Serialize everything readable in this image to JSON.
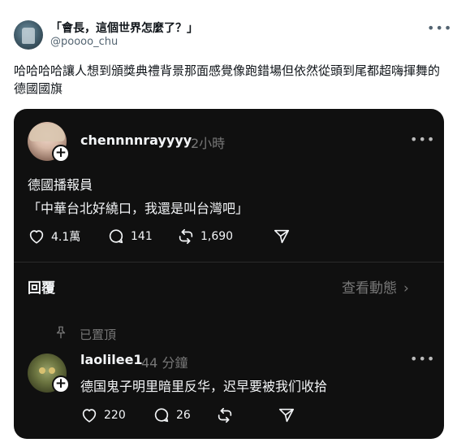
{
  "tweet": {
    "display_name": "「會長，這個世界怎麼了？」",
    "handle": "@poooo_chu",
    "more_icon": "more-horizontal-icon",
    "text": "哈哈哈哈讓人想到頒獎典禮背景那面感覺像跑錯場但依然從頭到尾都超嗨揮舞的德國國旗"
  },
  "card": {
    "post": {
      "username": "chennnnrayyyy",
      "time": "2小時",
      "line1": "德國播報員",
      "line2": "「中華台北好繞口，我還是叫台灣吧」",
      "likes": "4.1萬",
      "comments": "141",
      "reposts": "1,690"
    },
    "replies_label": "回覆",
    "view_activity": "查看動態",
    "view_activity_chevron": "›",
    "pinned_label": "已置頂",
    "reply": {
      "username": "laolilee1",
      "time": "44 分鐘",
      "text": "德国鬼子明里暗里反华，迟早要被我们收拾",
      "likes": "220",
      "comments": "26"
    },
    "colors": {
      "background": "#101010",
      "text": "#f3f5f7",
      "muted": "#777777"
    }
  }
}
